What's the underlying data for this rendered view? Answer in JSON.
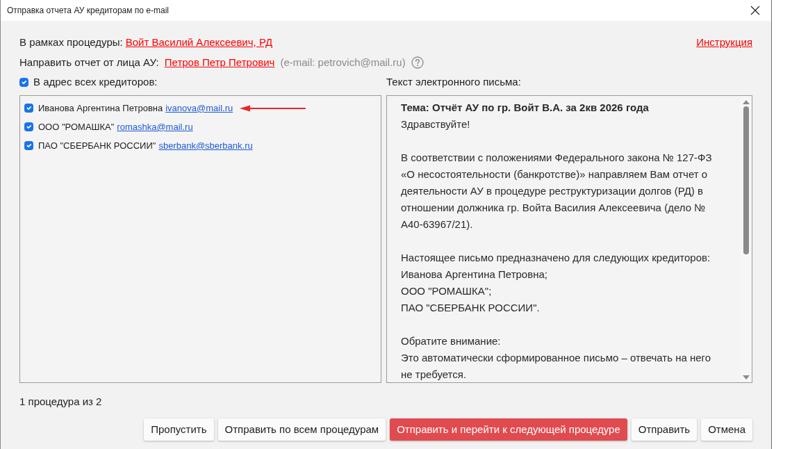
{
  "window": {
    "title": "Отправка отчета АУ кредиторам по e-mail"
  },
  "procedure": {
    "label": "В рамках процедуры:",
    "link": "Войт Василий Алексеевич, РД"
  },
  "instruction_link": "Инструкция",
  "sender": {
    "label": "Направить отчет от лица АУ:",
    "link": "Петров Петр Петрович",
    "email_note": "(e-mail: petrovich@mail.ru)"
  },
  "all_creditors": {
    "label": "В адрес всех кредиторов:",
    "checked": true
  },
  "creditors": [
    {
      "name": "Иванова Аргентина Петровна",
      "email": "ivanova@mail.ru",
      "checked": true,
      "pointed": true
    },
    {
      "name": "ООО \"РОМАШКА\"",
      "email": "romashka@mail.ru",
      "checked": true,
      "pointed": false
    },
    {
      "name": "ПАО \"СБЕРБАНК РОССИИ\"",
      "email": "sberbank@sberbank.ru",
      "checked": true,
      "pointed": false
    }
  ],
  "email_text": {
    "label": "Текст электронного письма:",
    "subject": "Тема: Отчёт АУ по гр. Войт В.А. за 2кв 2026 года",
    "paragraphs": [
      {
        "lines": [
          "Здравствуйте!"
        ]
      },
      {
        "lines": [
          "В соответствии с положениями Федерального закона № 127-ФЗ",
          "«О несостоятельности (банкротстве)» направляем Вам отчет о",
          "деятельности АУ в процедуре реструктуризации долгов (РД) в",
          "отношении должника гр. Войта Василия Алексеевича (дело №",
          "А40-63967/21)."
        ]
      },
      {
        "lines": [
          "Настоящее письмо предназначено для следующих кредиторов:",
          "Иванова Аргентина Петровна;",
          "ООО \"РОМАШКА\";",
          "ПАО \"СБЕРБАНК РОССИИ\"."
        ]
      },
      {
        "lines": [
          "Обратите внимание:",
          "Это автоматически сформированное письмо – отвечать на него",
          "не требуется."
        ]
      }
    ]
  },
  "counter": "1 процедура из 2",
  "buttons": [
    {
      "label": "Пропустить",
      "kind": "default"
    },
    {
      "label": "Отправить по всем процедурам",
      "kind": "default"
    },
    {
      "label": "Отправить и перейти к следующей процедуре",
      "kind": "primary"
    },
    {
      "label": "Отправить",
      "kind": "default"
    },
    {
      "label": "Отмена",
      "kind": "default"
    }
  ]
}
